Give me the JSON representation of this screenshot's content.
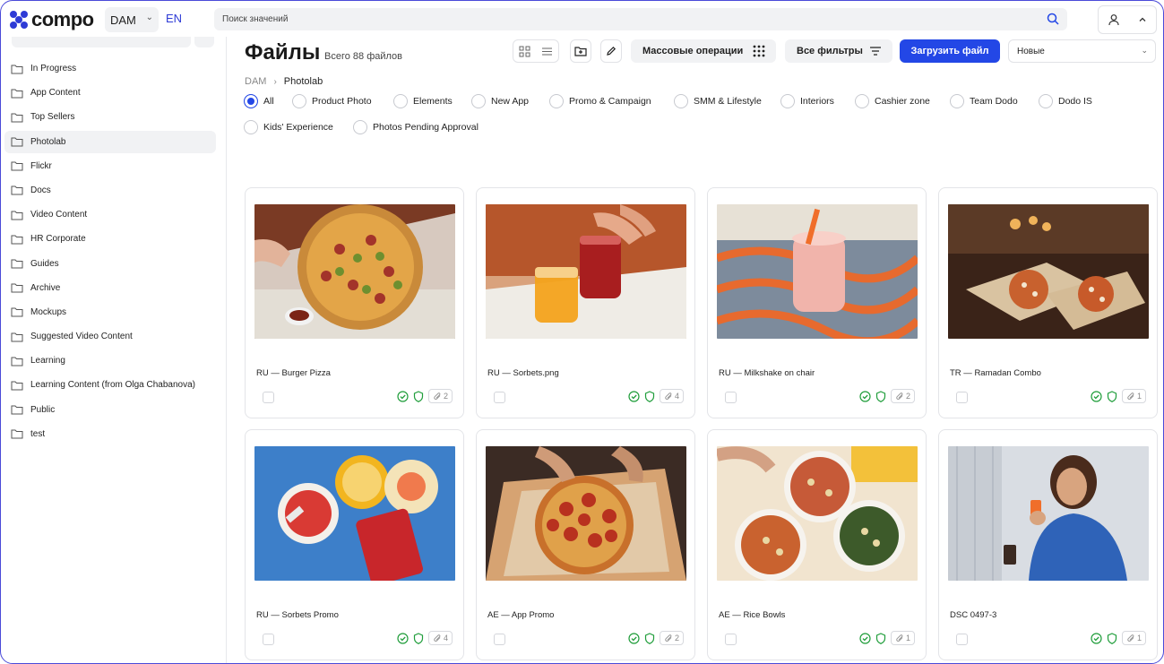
{
  "header": {
    "logo_text": "compo",
    "workspace": "DAM",
    "lang": "EN",
    "search_placeholder": "Поиск значений"
  },
  "sidebar": {
    "items": [
      {
        "label": "In Progress",
        "active": false
      },
      {
        "label": "App Content",
        "active": false
      },
      {
        "label": "Top Sellers",
        "active": false
      },
      {
        "label": "Photolab",
        "active": true
      },
      {
        "label": "Flickr",
        "active": false
      },
      {
        "label": "Docs",
        "active": false
      },
      {
        "label": "Video Content",
        "active": false
      },
      {
        "label": "HR Corporate",
        "active": false
      },
      {
        "label": "Guides",
        "active": false
      },
      {
        "label": "Archive",
        "active": false
      },
      {
        "label": "Mockups",
        "active": false
      },
      {
        "label": "Suggested Video Content",
        "active": false
      },
      {
        "label": "Learning",
        "active": false
      },
      {
        "label": "Learning Content (from Olga Chabanova)",
        "active": false
      },
      {
        "label": "Public",
        "active": false
      },
      {
        "label": "test",
        "active": false
      }
    ]
  },
  "main": {
    "title": "Файлы",
    "file_count": "Всего 88 файлов",
    "mass_ops_label": "Массовые операции",
    "all_filters_label": "Все фильтры",
    "upload_label": "Загрузить файл",
    "sort_value": "Новые",
    "breadcrumb": {
      "root": "DAM",
      "current": "Photolab"
    },
    "filters": [
      {
        "label": "All",
        "selected": true
      },
      {
        "label": "Product Photo",
        "selected": false
      },
      {
        "label": "Elements",
        "selected": false
      },
      {
        "label": "New App",
        "selected": false
      },
      {
        "label": "Promo & Campaign",
        "selected": false
      },
      {
        "label": "SMM & Lifestyle",
        "selected": false
      },
      {
        "label": "Interiors",
        "selected": false
      },
      {
        "label": "Cashier zone",
        "selected": false
      },
      {
        "label": "Team Dodo",
        "selected": false
      },
      {
        "label": "Dodo IS",
        "selected": false
      },
      {
        "label": "Kids' Experience",
        "selected": false
      },
      {
        "label": "Photos Pending Approval",
        "selected": false
      }
    ],
    "cards": [
      {
        "title": "RU — Burger Pizza",
        "attachments": "2",
        "image": "pizza-burger"
      },
      {
        "title": "RU — Sorbets.png",
        "attachments": "4",
        "image": "drinks"
      },
      {
        "title": "RU — Milkshake on chair",
        "attachments": "2",
        "image": "milkshake"
      },
      {
        "title": "TR — Ramadan Combo",
        "attachments": "1",
        "image": "ramadan"
      },
      {
        "title": "RU — Sorbets Promo",
        "attachments": "4",
        "image": "sorbets"
      },
      {
        "title": "AE — App Promo",
        "attachments": "2",
        "image": "pepperoni"
      },
      {
        "title": "AE — Rice Bowls",
        "attachments": "1",
        "image": "bowls"
      },
      {
        "title": "DSC 0497-3",
        "attachments": "1",
        "image": "woman"
      }
    ]
  },
  "colors": {
    "accent": "#2347e6",
    "status_green": "#1f9d3a"
  }
}
